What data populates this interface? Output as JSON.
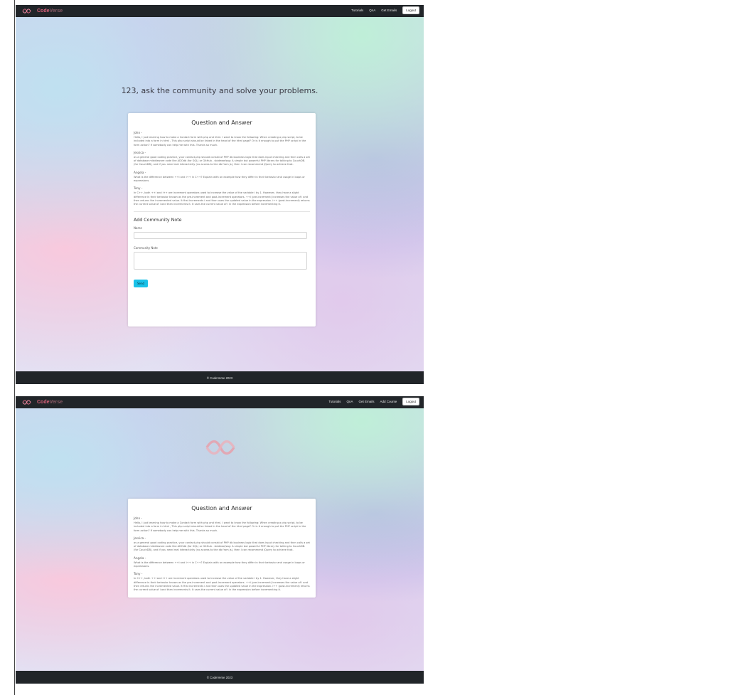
{
  "brand": {
    "name_part1": "Code",
    "name_part2": "Verse",
    "logo_icon": "codeverse-knot-logo",
    "accent_color": "#d8607a"
  },
  "screen1": {
    "nav": {
      "links": [
        "Tutorials",
        "QnA",
        "Get Emails"
      ],
      "logout_label": "Logout"
    },
    "hero_title": "123, ask the community and solve your problems.",
    "card": {
      "title": "Question and Answer",
      "items": [
        {
          "author": "John -",
          "text": "Hello, I just learning how to make a Contact form with php and html. I want to know the following: When creating a php script, to be included into a form in html , This php script should be linked in the head of the html page? Or is it enough to put the PHP script in the form action? If somebody can help me with this. Thanks so much."
        },
        {
          "author": "Jessica -",
          "text": "as a general good coding practice, your contact.php should consist of PHP db business logic that does input checking and then calls a set of database middleware code like ADOdb (for SQL) or GitHub - sbidewe/sag: A simple but powerful PHP library for talking to CouchDB. (for CouchDB), and if you need real interactivity (no access to the db from js), then I can recommend jQuery to achieve that."
        },
        {
          "author": "Angela -",
          "text": "What is the difference between ++i and i++ in C++? Explain with an example how they differ in their behavior and usage in loops or expressions."
        },
        {
          "author": "Tony -",
          "text": "In C++, both ++i and i++ are increment operators used to increase the value of the variable i by 1. However, they have a slight difference in their behavior known as the pre-increment and post-increment operators. ++i (pre-increment) increases the value of i and then returns the incremented value. It first increments i and then uses the updated value in the expression. i++ (post-increment) returns the current value of i and then increments it. It uses the current value of i in the expression before incrementing it."
        }
      ],
      "note_section": {
        "title": "Add Community Note",
        "name_label": "Name",
        "name_value": "",
        "note_label": "Community Note",
        "note_value": "",
        "send_label": "Send"
      }
    },
    "footer_text": "© CodeVerse 2023"
  },
  "screen2": {
    "nav": {
      "links": [
        "Tutorials",
        "QnA",
        "Get Emails",
        "Add Course"
      ],
      "logout_label": "Logout"
    },
    "card": {
      "title": "Question and Answer",
      "items": [
        {
          "author": "John -",
          "text": "Hello, I just learning how to make a Contact form with php and html. I want to know the following: When creating a php script, to be included into a form in html , This php script should be linked in the head of the html page? Or is it enough to put the PHP script in the form action? If somebody can help me with this. Thanks so much."
        },
        {
          "author": "Jessica -",
          "text": "as a general good coding practice, your contact.php should consist of PHP db business logic that does input checking and then calls a set of database middleware code like ADOdb (for SQL) or GitHub - sbidewe/sag: A simple but powerful PHP library for talking to CouchDB. (for CouchDB), and if you need real interactivity (no access to the db from js), then I can recommend jQuery to achieve that."
        },
        {
          "author": "Angela -",
          "text": "What is the difference between ++i and i++ in C++? Explain with an example how they differ in their behavior and usage in loops or expressions."
        },
        {
          "author": "Tony -",
          "text": "In C++, both ++i and i++ are increment operators used to increase the value of the variable i by 1. However, they have a slight difference in their behavior known as the pre-increment and post-increment operators. ++i (pre-increment) increases the value of i and then returns the incremented value. It first increments i and then uses the updated value in the expression. i++ (post-increment) returns the current value of i and then increments it. It uses the current value of i in the expression before incrementing it."
        }
      ]
    },
    "footer_text": "© CodeVerse 2023"
  }
}
